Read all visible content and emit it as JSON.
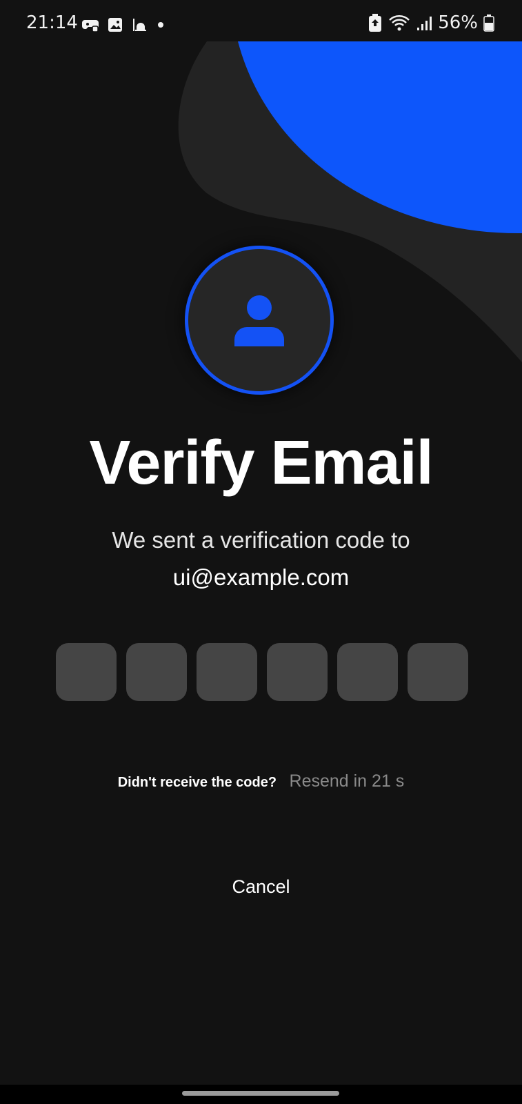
{
  "status_bar": {
    "time": "21:14",
    "left_icons": [
      "game-controller-icon",
      "image-icon",
      "mosque-icon",
      "dot-icon"
    ],
    "right_icons": [
      "battery-saver-icon",
      "wifi-icon",
      "signal-icon"
    ],
    "battery_percent": "56%"
  },
  "main": {
    "title": "Verify Email",
    "subtitle": "We sent a verification code to",
    "email": "ui@example.com",
    "code_length": 6,
    "resend_question": "Didn't receive the code?",
    "resend_countdown": "Resend in 21 s",
    "cancel_label": "Cancel"
  },
  "colors": {
    "background": "#121212",
    "accent": "#1452f5",
    "code_box": "#454545",
    "muted_text": "#8a8a8a"
  },
  "icons": {
    "avatar": "person-icon"
  }
}
